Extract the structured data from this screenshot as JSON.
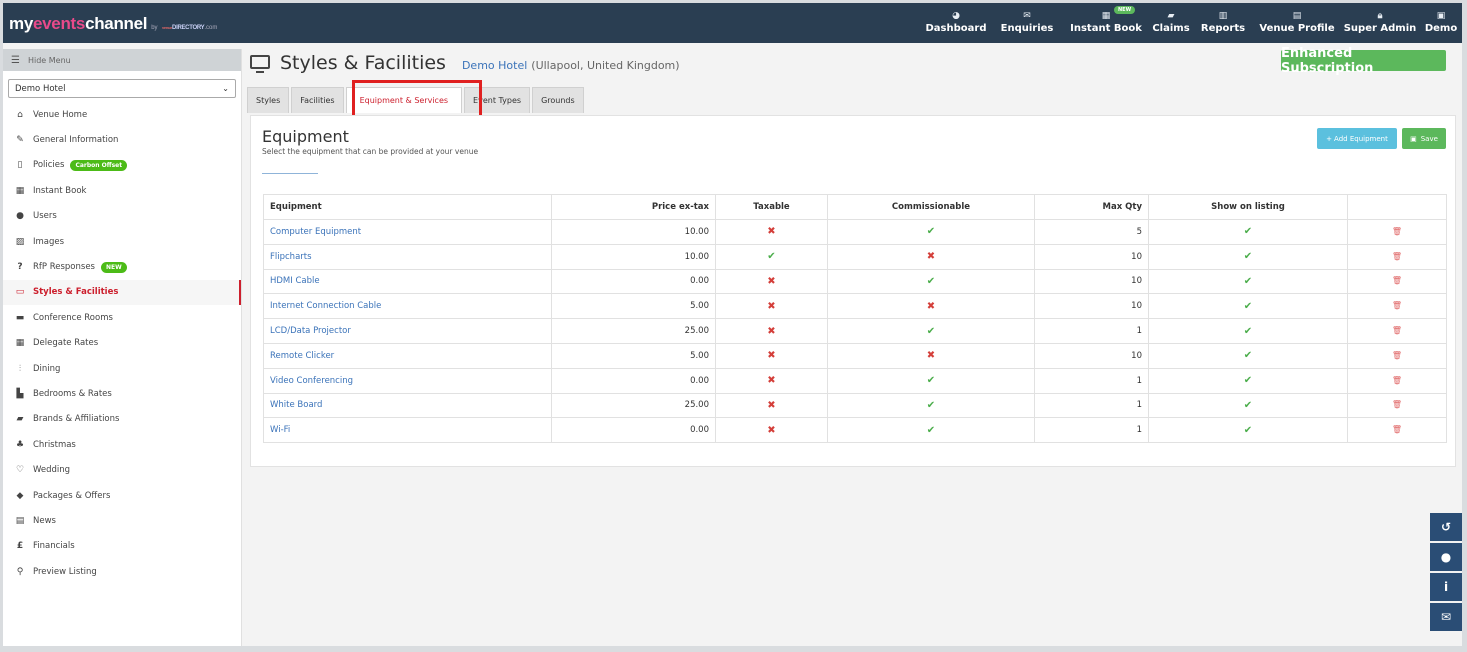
{
  "brand": {
    "name_prefix": "my",
    "name_accent": "events",
    "name_suffix": "channel",
    "by": "by",
    "directory": "DIRECTORY",
    "directory_super": "venue",
    "directory_tld": ".com"
  },
  "nav": [
    {
      "label": "Dashboard",
      "icon": "tachometer-icon"
    },
    {
      "label": "Enquiries",
      "icon": "envelope-icon"
    },
    {
      "label": "Instant Book",
      "icon": "calendar-icon",
      "badge": "NEW"
    },
    {
      "label": "Claims",
      "icon": "book-icon"
    },
    {
      "label": "Reports",
      "icon": "bar-chart-icon"
    },
    {
      "label": "Venue Profile",
      "icon": "building-icon"
    },
    {
      "label": "Super Admin",
      "icon": "lock-icon"
    },
    {
      "label": "Demo",
      "icon": "user-box-icon"
    }
  ],
  "sidebar": {
    "hide_menu": "Hide Menu",
    "venue_select": "Demo Hotel",
    "items": [
      {
        "label": "Venue Home",
        "icon": "home-icon"
      },
      {
        "label": "General Information",
        "icon": "edit-icon"
      },
      {
        "label": "Policies",
        "icon": "file-icon",
        "badge": "Carbon Offset"
      },
      {
        "label": "Instant Book",
        "icon": "calendar-icon"
      },
      {
        "label": "Users",
        "icon": "user-icon"
      },
      {
        "label": "Images",
        "icon": "image-icon"
      },
      {
        "label": "RfP Responses",
        "icon": "question-icon",
        "badge": "NEW"
      },
      {
        "label": "Styles & Facilities",
        "icon": "monitor-icon",
        "active": true
      },
      {
        "label": "Conference Rooms",
        "icon": "briefcase-icon"
      },
      {
        "label": "Delegate Rates",
        "icon": "calculator-icon"
      },
      {
        "label": "Dining",
        "icon": "cutlery-icon"
      },
      {
        "label": "Bedrooms & Rates",
        "icon": "bed-icon"
      },
      {
        "label": "Brands & Affiliations",
        "icon": "book-icon"
      },
      {
        "label": "Christmas",
        "icon": "tree-icon"
      },
      {
        "label": "Wedding",
        "icon": "heart-icon"
      },
      {
        "label": "Packages & Offers",
        "icon": "tags-icon"
      },
      {
        "label": "News",
        "icon": "newspaper-icon"
      },
      {
        "label": "Financials",
        "icon": "pound-icon"
      },
      {
        "label": "Preview Listing",
        "icon": "search-icon"
      }
    ]
  },
  "header": {
    "title": "Styles & Facilities",
    "venue_name": "Demo Hotel",
    "venue_location": "(Ullapool, United Kingdom)",
    "subscription": "Enhanced Subscription"
  },
  "tabs": [
    {
      "label": "Styles"
    },
    {
      "label": "Facilities"
    },
    {
      "label": "Equipment & Services",
      "active": true
    },
    {
      "label": "Event Types"
    },
    {
      "label": "Grounds"
    }
  ],
  "section": {
    "title": "Equipment",
    "description": "Select the equipment that can be provided at your venue",
    "add_button": "Add Equipment",
    "save_button": "Save"
  },
  "table": {
    "columns": [
      "Equipment",
      "Price ex-tax",
      "Taxable",
      "Commissionable",
      "Max Qty",
      "Show on listing",
      ""
    ],
    "rows": [
      {
        "name": "Computer Equipment",
        "price": "10.00",
        "taxable": false,
        "commissionable": true,
        "max_qty": "5",
        "show": true
      },
      {
        "name": "Flipcharts",
        "price": "10.00",
        "taxable": true,
        "commissionable": false,
        "max_qty": "10",
        "show": true
      },
      {
        "name": "HDMI Cable",
        "price": "0.00",
        "taxable": false,
        "commissionable": true,
        "max_qty": "10",
        "show": true
      },
      {
        "name": "Internet Connection Cable",
        "price": "5.00",
        "taxable": false,
        "commissionable": false,
        "max_qty": "10",
        "show": true
      },
      {
        "name": "LCD/Data Projector",
        "price": "25.00",
        "taxable": false,
        "commissionable": true,
        "max_qty": "1",
        "show": true
      },
      {
        "name": "Remote Clicker",
        "price": "5.00",
        "taxable": false,
        "commissionable": false,
        "max_qty": "10",
        "show": true
      },
      {
        "name": "Video Conferencing",
        "price": "0.00",
        "taxable": false,
        "commissionable": true,
        "max_qty": "1",
        "show": true
      },
      {
        "name": "White Board",
        "price": "25.00",
        "taxable": false,
        "commissionable": true,
        "max_qty": "1",
        "show": true
      },
      {
        "name": "Wi-Fi",
        "price": "0.00",
        "taxable": false,
        "commissionable": true,
        "max_qty": "1",
        "show": true
      }
    ]
  },
  "float_buttons": [
    "history-icon",
    "chat-icon",
    "info-icon",
    "mail-icon"
  ],
  "colors": {
    "topbar": "#2a3e52",
    "accent_red": "#cc1f2d",
    "green": "#5cb85c",
    "link_blue": "#3b73b9",
    "info_blue": "#5bc0de"
  }
}
